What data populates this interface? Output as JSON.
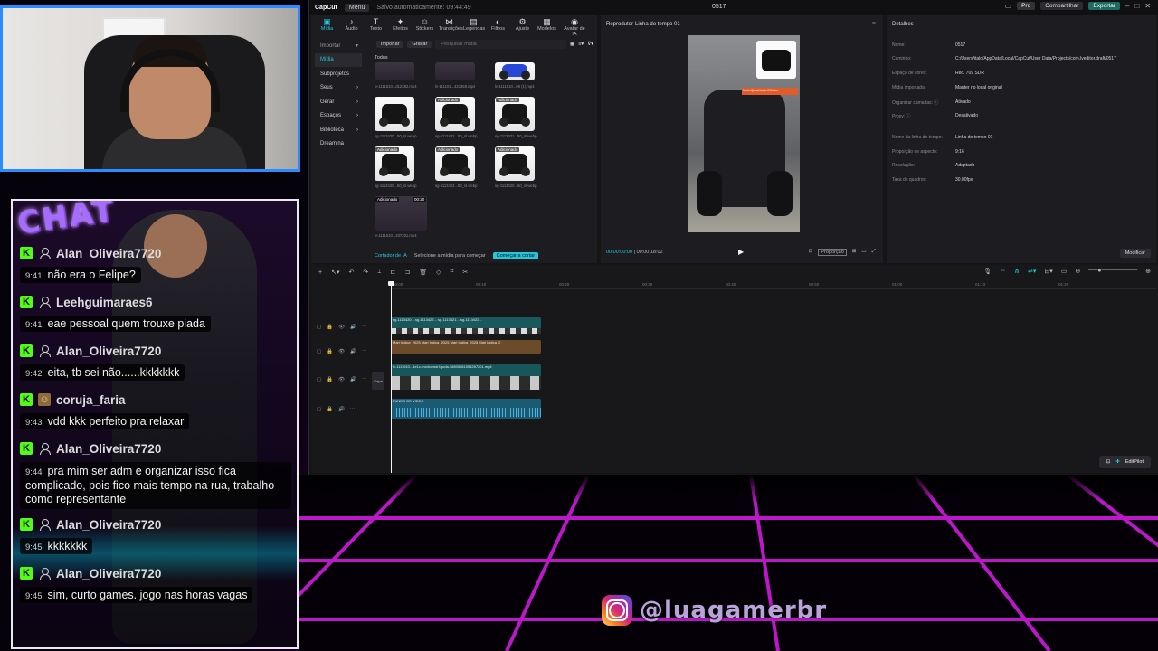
{
  "chat": {
    "title": "CHAT",
    "messages": [
      {
        "user": "Alan_Oliveira7720",
        "time": "9:41",
        "text": "não era o Felipe?",
        "badge": "K"
      },
      {
        "user": "Leehguimaraes6",
        "time": "9:41",
        "text": "eae pessoal quem trouxe piada",
        "badge": "K"
      },
      {
        "user": "Alan_Oliveira7720",
        "time": "9:42",
        "text": "eita, tb sei não......kkkkkkk",
        "badge": "K"
      },
      {
        "user": "coruja_faria",
        "time": "9:43",
        "text": "vdd kkk perfeito pra relaxar",
        "badge": "K"
      },
      {
        "user": "Alan_Oliveira7720",
        "time": "9:44",
        "text": "pra mim ser adm e organizar isso fica complicado, pois fico mais tempo na rua, trabalho como representante",
        "badge": "K"
      },
      {
        "user": "Alan_Oliveira7720",
        "time": "9:45",
        "text": "kkkkkkk",
        "badge": "K"
      },
      {
        "user": "Alan_Oliveira7720",
        "time": "9:45",
        "text": "sim, curto games. jogo nas horas vagas",
        "badge": "K"
      }
    ]
  },
  "capcut": {
    "logo": "CapCut",
    "menu": "Menu",
    "saved": "Salvo automaticamente: 09:44:49",
    "project": "0517",
    "pro": "Pro",
    "share": "Compartilhar",
    "export": "Exportar",
    "tools": [
      {
        "label": "Mídia",
        "glyph": "▣"
      },
      {
        "label": "Áudio",
        "glyph": "♪"
      },
      {
        "label": "Texto",
        "glyph": "T"
      },
      {
        "label": "Efeitos",
        "glyph": "✦"
      },
      {
        "label": "Stickers",
        "glyph": "☺"
      },
      {
        "label": "Transições",
        "glyph": "⋈"
      },
      {
        "label": "Legendas",
        "glyph": "▤"
      },
      {
        "label": "Filtros",
        "glyph": "◐"
      },
      {
        "label": "Ajuste",
        "glyph": "⚙"
      },
      {
        "label": "Modelos",
        "glyph": "▦"
      },
      {
        "label": "Avatar de IA",
        "glyph": "◉"
      }
    ],
    "sidenav": [
      "Importar",
      "Mídia",
      "Subprojetos",
      "Seus",
      "Gerar",
      "Espaços",
      "Biblioteca",
      "Dreamina"
    ],
    "media_bar": {
      "import": "Importar",
      "record": "Gravar",
      "search_placeholder": "Pesquisar mídia"
    },
    "todos": "Todos",
    "added_label": "Adicionado",
    "thumb_duration": "00:20",
    "captions": [
      "lv-1111610...d12382.mp4",
      "lv-111101...433358.mp4",
      "lv-1111610...99 (1).mp4",
      "sg-1113420...50_nl.webp",
      "sg-1113422...50_nl.webp",
      "sg-1113421...50_nl.webp",
      "sg-1113420...50_nl.webp",
      "sg-1113422...50_nl.webp",
      "sg-1113420...50_nl.webp",
      "lv-1111610...207201.mp4"
    ],
    "media_footer": {
      "ai_cut": "Cortador de IA",
      "hint": "Selecione a mídia para começar",
      "cta": "Começar a cortar"
    },
    "player": {
      "title": "Reprodutor-Linha do tempo 01",
      "current": "00:00:00:00",
      "total": "00:00:18:02",
      "inset_label": "Moto-Quadriciclo Elétrico",
      "proportion": "Proporção"
    },
    "details": {
      "title": "Detalhes",
      "rows": [
        {
          "k": "Nome:",
          "v": "0517"
        },
        {
          "k": "Caminho:",
          "v": "C:/Users/italo/AppData/Local/CapCut/User Data/Projects/com.lveditor.draft/0517"
        },
        {
          "k": "Espaço de cores:",
          "v": "Rec. 709 SDR"
        },
        {
          "k": "Mídia importada:",
          "v": "Manter no local original"
        },
        {
          "k": "Organizar camadas: ⓘ",
          "v": "Ativado"
        },
        {
          "k": "Proxy: ⓘ",
          "v": "Desativado"
        },
        {
          "k": "Nome da linha do tempo:",
          "v": "Linha do tempo 01"
        },
        {
          "k": "Proporção de aspecto:",
          "v": "9:16"
        },
        {
          "k": "Resolução:",
          "v": "Adaptado"
        },
        {
          "k": "Taxa de quadros:",
          "v": "30.00fps"
        }
      ],
      "modify": "Modificar"
    },
    "timeline": {
      "ruler": [
        "00:00",
        "00:10",
        "00:20",
        "00:30",
        "00:40",
        "00:50",
        "01:00",
        "01:10",
        "01:20"
      ],
      "cover": "Capa",
      "clip_top": "sg-1113420...  sg-1113422...  sg-1113421...  sg-1113422...",
      "clip_text": "Mari Indica_2025  Mari Indica_2025  Mari Indica_2025  Mari Indica_2",
      "clip_main": "lv-1111610...4e1c-mo4cowdr1guda.16800081058267201.mp4",
      "clip_audio": "FUNDO DE VIDEO",
      "editpilot": "EditPilot"
    }
  },
  "instagram": {
    "handle": "@luagamerbr"
  }
}
